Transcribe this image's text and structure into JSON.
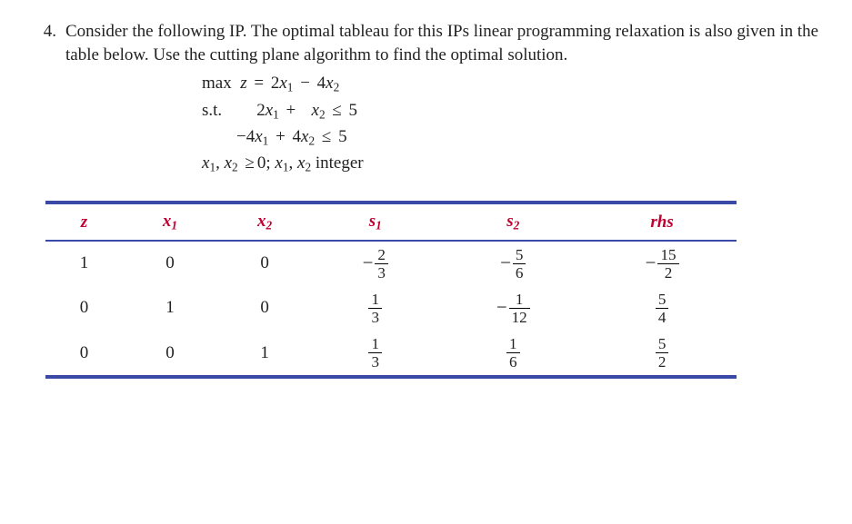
{
  "problem": {
    "number": "4.",
    "text": "Consider the following IP. The optimal tableau for this IPs linear programming relaxation is also given in the table below. Use the cutting plane algorithm to find the optimal solution."
  },
  "math": {
    "obj_label": "max",
    "obj_var": "z",
    "eq": "=",
    "obj_rhs_1_coef": "2",
    "obj_rhs_1_var": "x",
    "obj_rhs_1_sub": "1",
    "obj_minus": "−",
    "obj_rhs_2_coef": "4",
    "obj_rhs_2_var": "x",
    "obj_rhs_2_sub": "2",
    "st": "s.t.",
    "c1_a": "2",
    "c1_av": "x",
    "c1_as": "1",
    "c1_op": "+",
    "c1_b": "",
    "c1_bv": "x",
    "c1_bs": "2",
    "c1_rel": "≤",
    "c1_rhs": "5",
    "c2_a": "−4",
    "c2_av": "x",
    "c2_as": "1",
    "c2_op": "+",
    "c2_b": "4",
    "c2_bv": "x",
    "c2_bs": "2",
    "c2_rel": "≤",
    "c2_rhs": "5",
    "dom_a": "x",
    "dom_as": "1",
    "dom_comma1": ", ",
    "dom_b": "x",
    "dom_bs": "2",
    "dom_rel": "≥",
    "dom_rhs": "0",
    "dom_semi": "; ",
    "dom_c": "x",
    "dom_cs": "1",
    "dom_comma2": ", ",
    "dom_d": "x",
    "dom_ds": "2",
    "dom_int": " integer"
  },
  "table": {
    "head": {
      "z": "z",
      "x1v": "x",
      "x1s": "1",
      "x2v": "x",
      "x2s": "2",
      "s1v": "s",
      "s1s": "1",
      "s2v": "s",
      "s2s": "2",
      "rhs": "rhs"
    },
    "rows": [
      {
        "z": "1",
        "x1": "0",
        "x2": "0",
        "s1": {
          "neg": true,
          "n": "2",
          "d": "3"
        },
        "s2": {
          "neg": true,
          "n": "5",
          "d": "6"
        },
        "rhs": {
          "neg": true,
          "n": "15",
          "d": "2"
        }
      },
      {
        "z": "0",
        "x1": "1",
        "x2": "0",
        "s1": {
          "neg": false,
          "n": "1",
          "d": "3"
        },
        "s2": {
          "neg": true,
          "n": "1",
          "d": "12"
        },
        "rhs": {
          "neg": false,
          "n": "5",
          "d": "4"
        }
      },
      {
        "z": "0",
        "x1": "0",
        "x2": "1",
        "s1": {
          "neg": false,
          "n": "1",
          "d": "3"
        },
        "s2": {
          "neg": false,
          "n": "1",
          "d": "6"
        },
        "rhs": {
          "neg": false,
          "n": "5",
          "d": "2"
        }
      }
    ]
  },
  "chart_data": {
    "type": "table",
    "title": "Optimal tableau for LP relaxation",
    "columns": [
      "z",
      "x1",
      "x2",
      "s1",
      "s2",
      "rhs"
    ],
    "rows": [
      {
        "z": 1,
        "x1": 0,
        "x2": 0,
        "s1": "-2/3",
        "s2": "-5/6",
        "rhs": "-15/2"
      },
      {
        "z": 0,
        "x1": 1,
        "x2": 0,
        "s1": "1/3",
        "s2": "-1/12",
        "rhs": "5/4"
      },
      {
        "z": 0,
        "x1": 0,
        "x2": 1,
        "s1": "1/3",
        "s2": "1/6",
        "rhs": "5/2"
      }
    ]
  }
}
